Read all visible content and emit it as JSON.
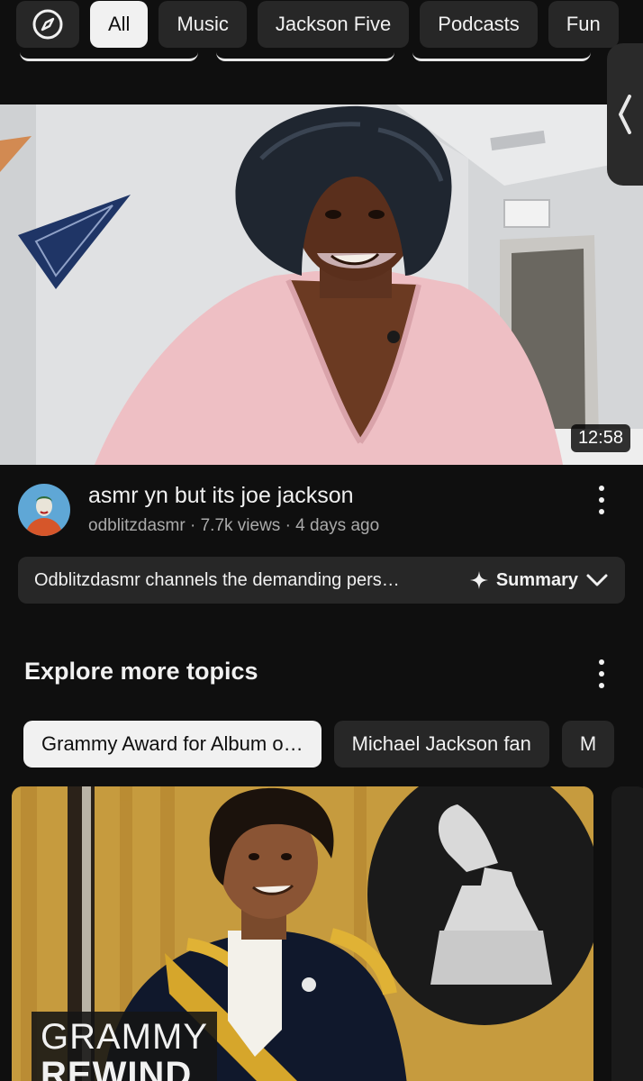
{
  "chips": {
    "explore_icon": "compass-icon",
    "items": [
      "All",
      "Music",
      "Jackson Five",
      "Podcasts",
      "Fun"
    ]
  },
  "video": {
    "duration": "12:58",
    "title": "asmr yn but its joe jackson",
    "meta": "odblitzdasmr · 7.7k views · 4 days ago",
    "summary_text": "Odblitzdasmr channels the demanding pers…",
    "summary_label": "Summary"
  },
  "explore": {
    "title": "Explore more topics",
    "topics": [
      "Grammy Award for Album o…",
      "Michael Jackson fan",
      "M"
    ],
    "card_overlay": {
      "line1": "GRAMMY",
      "line2": "REWIND"
    }
  },
  "colors": {
    "background": "#0f0f0f",
    "chip": "#272727",
    "chip_active": "#f1f1f1",
    "text_secondary": "#aaaaaa"
  }
}
